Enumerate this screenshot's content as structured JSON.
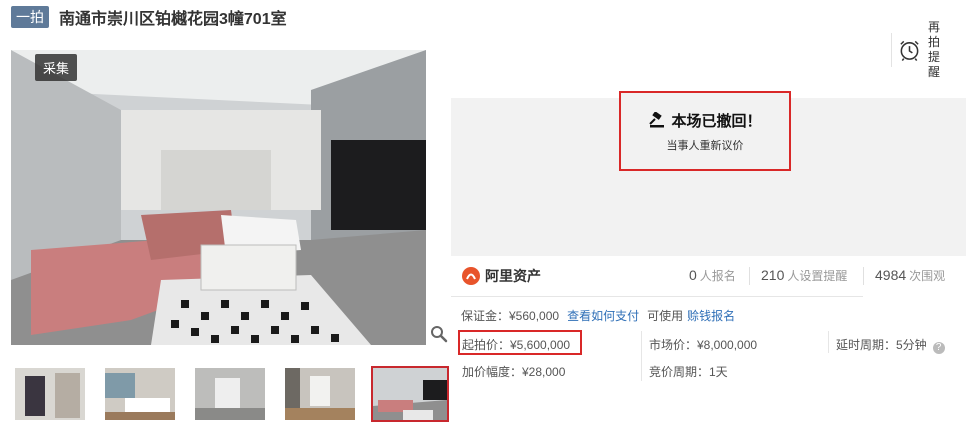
{
  "header": {
    "badge": "一拍",
    "title": "南通市崇川区铂樾花园3幢701室"
  },
  "gallery": {
    "tag": "采集",
    "zoom_icon": "magnifier-icon",
    "thumbnails": [
      "thumb-1",
      "thumb-2",
      "thumb-3",
      "thumb-4",
      "thumb-5"
    ],
    "selected_index": 4
  },
  "remind": {
    "line1": "再拍",
    "line2": "提醒"
  },
  "status": {
    "title": "本场已撤回！",
    "subtitle": "当事人重新议价",
    "icon": "gavel-icon"
  },
  "stats": {
    "logo_text": "阿里资产",
    "signup_count": "0",
    "signup_label": "人报名",
    "reminder_count": "210",
    "reminder_label": "人设置提醒",
    "views_count": "4984",
    "views_label": "次围观"
  },
  "fees": {
    "deposit": "保证金：¥560,000",
    "how_to_pay": "查看如何支付",
    "available": "可使用",
    "loan_signup": "赊钱报名"
  },
  "info": {
    "start_price": "起拍价：¥5,600,000",
    "market_price": "市场价：¥8,000,000",
    "delay_period": "延时周期：5分钟",
    "increment": "加价幅度：¥28,000",
    "bid_period": "竞价周期：1天"
  },
  "colors": {
    "accent_red": "#d92828",
    "link_blue": "#2f6fb7",
    "badge_bg": "#5f7a99"
  }
}
